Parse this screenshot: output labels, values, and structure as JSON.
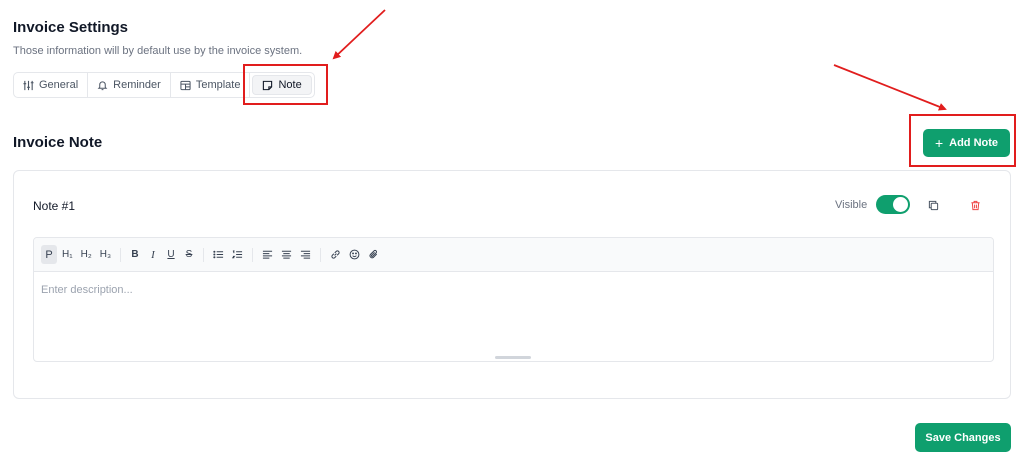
{
  "header": {
    "title": "Invoice Settings",
    "subtitle": "Those information will by default use by the invoice system."
  },
  "tabs": [
    {
      "label": "General",
      "icon": "sliders-icon"
    },
    {
      "label": "Reminder",
      "icon": "bell-icon"
    },
    {
      "label": "Template",
      "icon": "template-icon"
    },
    {
      "label": "Note",
      "icon": "note-icon",
      "active": true
    }
  ],
  "section": {
    "title": "Invoice Note",
    "add_button_label": "Add Note",
    "add_button_icon": "+"
  },
  "note": {
    "title": "Note #1",
    "visible_label": "Visible",
    "visible": true,
    "editor": {
      "placeholder": "Enter description...",
      "toolbar": {
        "paragraph": "P",
        "h1": "H₁",
        "h2": "H₂",
        "h3": "H₃",
        "bold": "B",
        "italic": "I",
        "underline": "U",
        "strike": "S"
      }
    }
  },
  "footer": {
    "save_label": "Save Changes"
  },
  "colors": {
    "accent": "#0f9f6e",
    "highlight": "#e11d1d",
    "delete": "#ef4444"
  }
}
